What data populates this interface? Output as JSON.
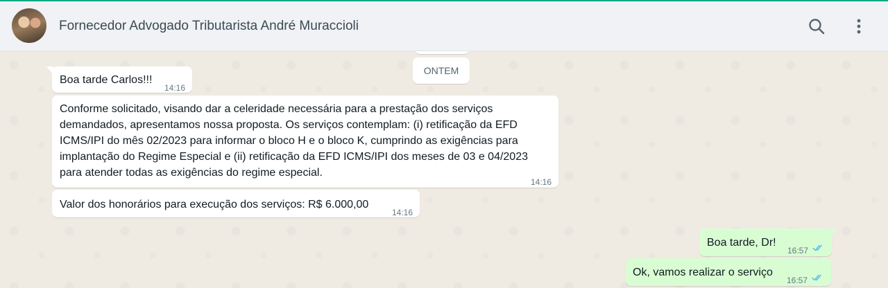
{
  "header": {
    "contact_name": "Fornecedor Advogado Tributarista André Muraccioli",
    "search_icon": "search-icon",
    "menu_icon": "kebab-menu-icon"
  },
  "chat": {
    "date_divider": "ONTEM",
    "messages": [
      {
        "direction": "in",
        "text": "Boa tarde Carlos!!!",
        "time": "14:16"
      },
      {
        "direction": "in",
        "text": "Conforme solicitado, visando dar a celeridade necessária para a prestação dos serviços demandados, apresentamos nossa proposta. Os serviços contemplam: (i) retificação da EFD ICMS/IPI do mês 02/2023 para informar o bloco H e o bloco K, cumprindo as exigências para implantação do Regime Especial e (ii) retificação da EFD ICMS/IPI dos meses de 03 e 04/2023 para atender todas as exigências do regime especial.",
        "time": "14:16"
      },
      {
        "direction": "in",
        "text": "Valor dos honorários para execução dos serviços: R$ 6.000,00",
        "time": "14:16"
      },
      {
        "direction": "out",
        "text": "Boa tarde, Dr!",
        "time": "16:57",
        "status": "read"
      },
      {
        "direction": "out",
        "text": "Ok, vamos realizar o serviço",
        "time": "16:57",
        "status": "read"
      }
    ]
  },
  "colors": {
    "accent": "#00a884",
    "header_bg": "#f0f2f5",
    "chat_bg": "#efeae2",
    "incoming_bubble": "#ffffff",
    "outgoing_bubble": "#d9fdd3",
    "read_ticks": "#53bdeb"
  }
}
